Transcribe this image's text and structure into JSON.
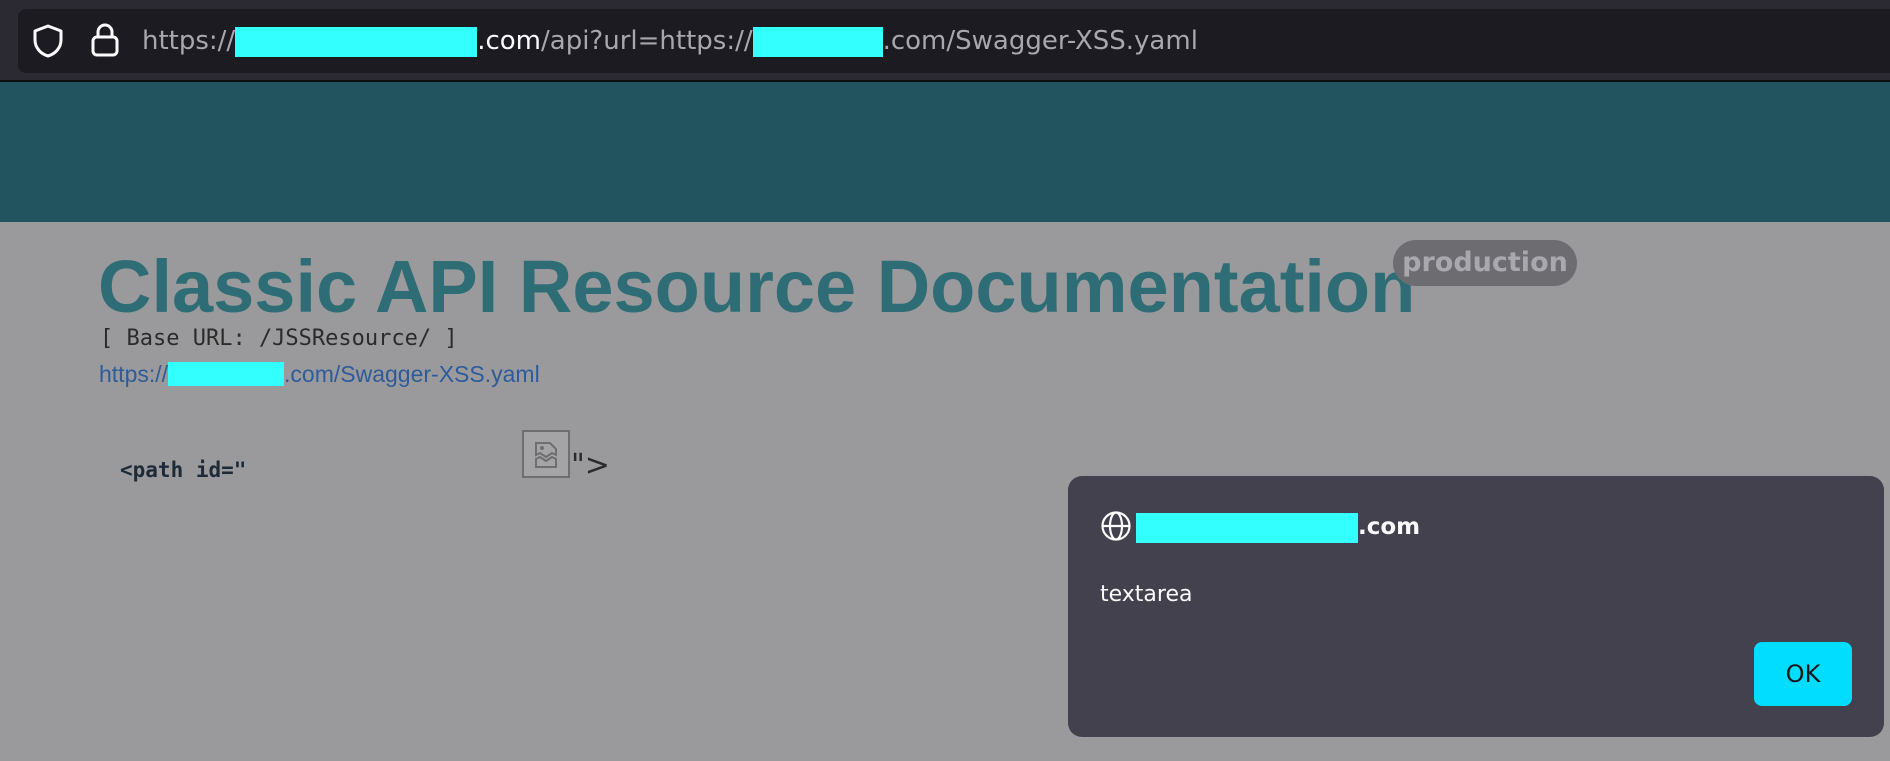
{
  "browser": {
    "url_prefix": "https://",
    "url_host_suffix": ".com",
    "url_path": "/api?url=https://",
    "url_tail": ".com/Swagger-XSS.yaml",
    "icons": [
      "shield-icon",
      "lock-icon"
    ]
  },
  "page": {
    "title": "Classic API Resource Documentation",
    "badge": "production",
    "base_url_text": "[ Base URL: /JSSResource/ ]",
    "spec_link_prefix": "https://",
    "spec_link_suffix": ".com/Swagger-XSS.yaml",
    "injected_code": "<path id=\"",
    "injected_closer": "\">",
    "broken_image_icon": "broken-image-icon"
  },
  "dialog": {
    "origin_suffix": ".com",
    "message": "textarea",
    "ok_label": "OK",
    "icon": "globe-icon"
  },
  "colors": {
    "redaction": "#33ffff",
    "header_band": "#225460",
    "title": "#2f6d76",
    "dialog_bg": "#42414d",
    "ok_button": "#00ddff"
  }
}
